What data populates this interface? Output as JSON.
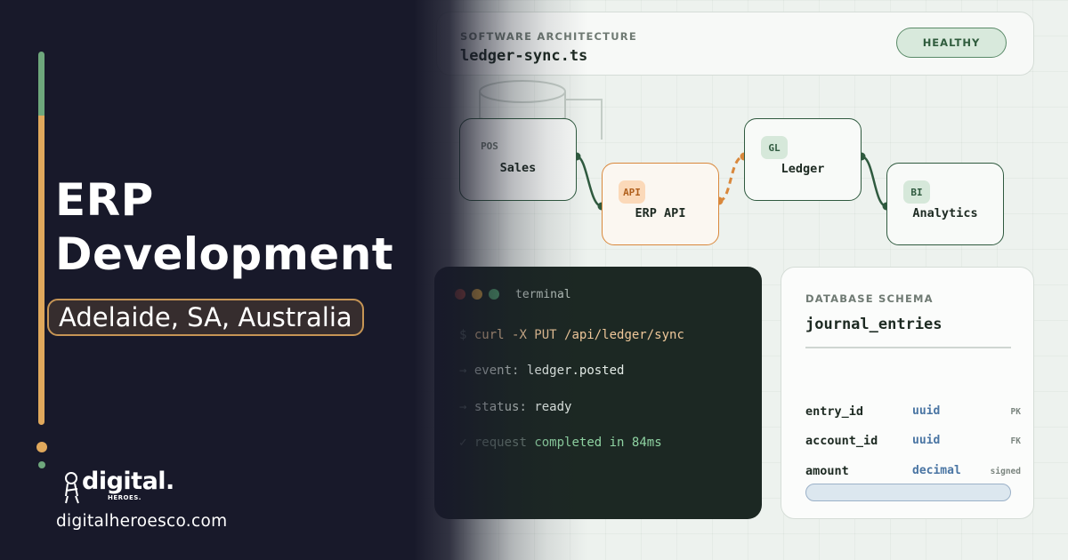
{
  "architecture_card": {
    "kicker": "SOFTWARE ARCHITECTURE",
    "file_name": "ledger-sync.ts",
    "status_badge": "HEALTHY"
  },
  "nodes": [
    {
      "tag": "POS",
      "label": "Sales"
    },
    {
      "tag": "API",
      "label": "ERP API"
    },
    {
      "tag": "GL",
      "label": "Ledger"
    },
    {
      "tag": "BI",
      "label": "Analytics"
    }
  ],
  "terminal": {
    "title": "terminal",
    "dot_colors": [
      "#c8553d",
      "#d9a441",
      "#4f9a6a"
    ],
    "lines": [
      {
        "prefix": "$",
        "text": "curl -X PUT /api/ledger/sync"
      },
      {
        "prefix": "→",
        "label": "event:",
        "value": "ledger.posted"
      },
      {
        "prefix": "→",
        "label": "status:",
        "value": "ready"
      },
      {
        "prefix": "✓",
        "label": "request",
        "value": "completed in 84ms"
      }
    ]
  },
  "schema": {
    "kicker": "DATABASE SCHEMA",
    "table": "journal_entries",
    "rows": [
      {
        "column": "entry_id",
        "type": "uuid",
        "flag": "PK"
      },
      {
        "column": "account_id",
        "type": "uuid",
        "flag": "FK"
      },
      {
        "column": "amount",
        "type": "decimal",
        "flag": "signed"
      }
    ]
  },
  "hero": {
    "title_line1": "ERP",
    "title_line2": "Development",
    "location": "Adelaide, SA, Australia",
    "website": "digitalheroesco.com"
  },
  "brand": {
    "logo_word": "digital.",
    "logo_sub": "HEROES.",
    "accent_green": "#6ea77c",
    "accent_orange": "#e0a85c",
    "panel_dark": "#18192a"
  }
}
